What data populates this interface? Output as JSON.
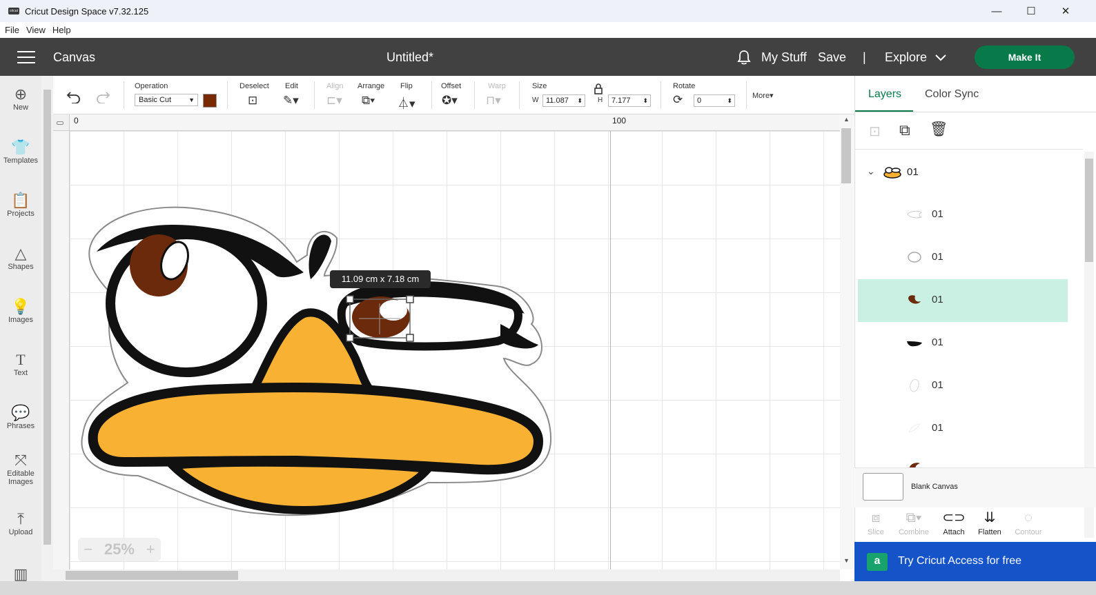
{
  "window": {
    "title": "Cricut Design Space  v7.32.125",
    "minimize": "—",
    "maximize": "☐",
    "close": "✕"
  },
  "menu": [
    "File",
    "View",
    "Help"
  ],
  "header": {
    "section": "Canvas",
    "doc_title": "Untitled*",
    "my_stuff": "My Stuff",
    "save": "Save",
    "divider": "|",
    "explore": "Explore",
    "make_it": "Make It"
  },
  "sidebar": [
    {
      "label": "New",
      "icon": "plus-circle-icon"
    },
    {
      "label": "Templates",
      "icon": "shirt-icon"
    },
    {
      "label": "Projects",
      "icon": "clipboard-icon"
    },
    {
      "label": "Shapes",
      "icon": "shapes-icon"
    },
    {
      "label": "Images",
      "icon": "lightbulb-icon"
    },
    {
      "label": "Text",
      "icon": "text-icon"
    },
    {
      "label": "Phrases",
      "icon": "speech-bubble-icon"
    },
    {
      "label": "Editable Images",
      "icon": "editable-image-icon"
    },
    {
      "label": "Upload",
      "icon": "upload-icon"
    }
  ],
  "toolbar": {
    "operation_label": "Operation",
    "operation_value": "Basic Cut",
    "operation_color": "#7a2a00",
    "deselect": "Deselect",
    "edit": "Edit",
    "align": "Align",
    "arrange": "Arrange",
    "flip": "Flip",
    "offset": "Offset",
    "warp": "Warp",
    "size": "Size",
    "w_label": "W",
    "w_value": "11.087",
    "h_label": "H",
    "h_value": "7.177",
    "rotate": "Rotate",
    "rotate_value": "0",
    "more": "More▾"
  },
  "ruler": {
    "mark0": "0",
    "mark100": "100"
  },
  "tooltip": "11.09  cm x 7.18  cm",
  "zoom": {
    "value": "25%",
    "minus": "−",
    "plus": "+"
  },
  "panel": {
    "tabs": [
      "Layers",
      "Color Sync"
    ],
    "group_name": "01",
    "layers": [
      {
        "name": "01",
        "selected": false
      },
      {
        "name": "01",
        "selected": false
      },
      {
        "name": "01",
        "selected": true
      },
      {
        "name": "01",
        "selected": false
      },
      {
        "name": "01",
        "selected": false
      },
      {
        "name": "01",
        "selected": false
      }
    ],
    "blank_canvas": "Blank Canvas",
    "actions": [
      {
        "label": "Slice",
        "enabled": false
      },
      {
        "label": "Combine",
        "enabled": false
      },
      {
        "label": "Attach",
        "enabled": true
      },
      {
        "label": "Flatten",
        "enabled": true
      },
      {
        "label": "Contour",
        "enabled": false
      }
    ],
    "banner": "Try Cricut Access for free"
  },
  "colors": {
    "header": "#414141",
    "make_it": "#087a4a",
    "selected_layer": "#c9f0e2",
    "banner": "#1553c9",
    "beak": "#f8b133",
    "iris": "#6b2a0b"
  }
}
